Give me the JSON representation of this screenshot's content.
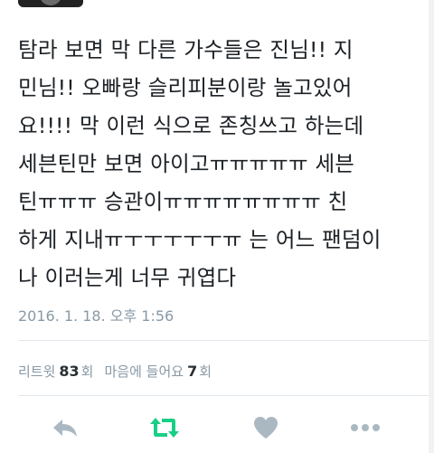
{
  "tweet": {
    "text": "탐라 보면 막 다른 가수들은 진님!! 지\n민님!! 오빠랑 슬리피분이랑 놀고있어\n요!!!! 막 이런 식으로 존칭쓰고 하는데\n세븐틴만 보면 아이고ㅠㅠㅠㅠㅠ 세븐\n틴ㅠㅠㅠ 승관이ㅠㅠㅠㅠㅠㅠㅠㅠ 친\n하게 지내ㅠㅜㅜㅜㅜㅜㅠ 는 어느 팬덤이\n나 이러는게 너무 귀엽다",
    "timestamp": "2016. 1. 18. 오후 1:56"
  },
  "stats": {
    "retweets_label": "리트윗",
    "retweets_count": "83",
    "retweets_unit": "회",
    "likes_label": "마음에 들어요",
    "likes_count": "7",
    "likes_unit": "회"
  },
  "actions": {
    "reply_icon": "reply-icon",
    "retweet_icon": "retweet-icon",
    "like_icon": "heart-icon",
    "more_icon": "more-icon"
  },
  "colors": {
    "text": "#1c2126",
    "muted": "#8899a6",
    "retweet_active": "#19cf86",
    "icon_gray": "#aab8c2"
  }
}
